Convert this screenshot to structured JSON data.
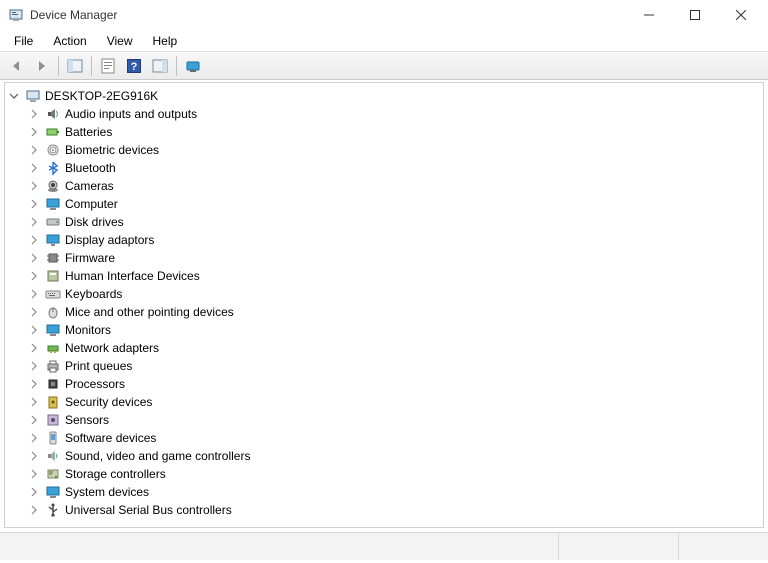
{
  "window": {
    "title": "Device Manager"
  },
  "menu": {
    "items": [
      "File",
      "Action",
      "View",
      "Help"
    ]
  },
  "toolbar": {
    "back": "Back",
    "forward": "Forward",
    "show_hide_tree": "Show/Hide Console Tree",
    "properties": "Properties",
    "help": "Help",
    "show_hide_action": "Show/Hide Action Pane",
    "scan": "Scan for hardware changes"
  },
  "tree": {
    "root": "DESKTOP-2EG916K",
    "categories": [
      {
        "label": "Audio inputs and outputs",
        "icon": "speaker-icon"
      },
      {
        "label": "Batteries",
        "icon": "battery-icon"
      },
      {
        "label": "Biometric devices",
        "icon": "fingerprint-icon"
      },
      {
        "label": "Bluetooth",
        "icon": "bluetooth-icon"
      },
      {
        "label": "Cameras",
        "icon": "camera-icon"
      },
      {
        "label": "Computer",
        "icon": "computer-icon"
      },
      {
        "label": "Disk drives",
        "icon": "disk-icon"
      },
      {
        "label": "Display adaptors",
        "icon": "display-icon"
      },
      {
        "label": "Firmware",
        "icon": "chip-icon"
      },
      {
        "label": "Human Interface Devices",
        "icon": "hid-icon"
      },
      {
        "label": "Keyboards",
        "icon": "keyboard-icon"
      },
      {
        "label": "Mice and other pointing devices",
        "icon": "mouse-icon"
      },
      {
        "label": "Monitors",
        "icon": "monitor-icon"
      },
      {
        "label": "Network adapters",
        "icon": "network-icon"
      },
      {
        "label": "Print queues",
        "icon": "printer-icon"
      },
      {
        "label": "Processors",
        "icon": "cpu-icon"
      },
      {
        "label": "Security devices",
        "icon": "security-icon"
      },
      {
        "label": "Sensors",
        "icon": "sensor-icon"
      },
      {
        "label": "Software devices",
        "icon": "software-icon"
      },
      {
        "label": "Sound, video and game controllers",
        "icon": "sound-icon"
      },
      {
        "label": "Storage controllers",
        "icon": "storage-icon"
      },
      {
        "label": "System devices",
        "icon": "system-icon"
      },
      {
        "label": "Universal Serial Bus controllers",
        "icon": "usb-icon"
      }
    ]
  }
}
